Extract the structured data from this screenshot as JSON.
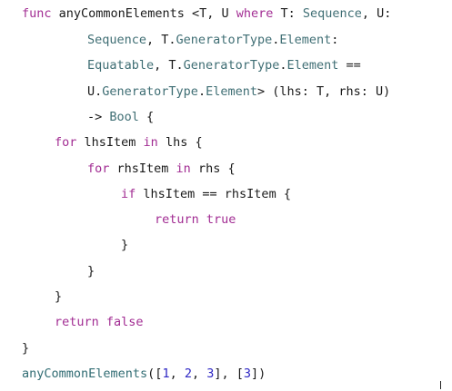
{
  "code_lines": [
    [
      {
        "t": "func",
        "c": "kw"
      },
      {
        "t": " ",
        "c": "pl"
      },
      {
        "t": "anyCommonElements",
        "c": "pl"
      },
      {
        "t": " <T, U ",
        "c": "pl"
      },
      {
        "t": "where",
        "c": "kw"
      },
      {
        "t": " T: ",
        "c": "pl"
      },
      {
        "t": "Sequence",
        "c": "ty"
      },
      {
        "t": ", U:",
        "c": "pl"
      }
    ],
    [
      {
        "t": "Sequence",
        "c": "ty"
      },
      {
        "t": ", T.",
        "c": "pl"
      },
      {
        "t": "GeneratorType",
        "c": "ty"
      },
      {
        "t": ".",
        "c": "pl"
      },
      {
        "t": "Element",
        "c": "ty"
      },
      {
        "t": ":",
        "c": "pl"
      }
    ],
    [
      {
        "t": "Equatable",
        "c": "ty"
      },
      {
        "t": ", T.",
        "c": "pl"
      },
      {
        "t": "GeneratorType",
        "c": "ty"
      },
      {
        "t": ".",
        "c": "pl"
      },
      {
        "t": "Element",
        "c": "ty"
      },
      {
        "t": " ==",
        "c": "pl"
      }
    ],
    [
      {
        "t": "U.",
        "c": "pl"
      },
      {
        "t": "GeneratorType",
        "c": "ty"
      },
      {
        "t": ".",
        "c": "pl"
      },
      {
        "t": "Element",
        "c": "ty"
      },
      {
        "t": "> (lhs: T, rhs: U)",
        "c": "pl"
      }
    ],
    [
      {
        "t": "-> ",
        "c": "pl"
      },
      {
        "t": "Bool",
        "c": "ty"
      },
      {
        "t": " {",
        "c": "pl"
      }
    ],
    [
      {
        "t": "for",
        "c": "kw"
      },
      {
        "t": " lhsItem ",
        "c": "pl"
      },
      {
        "t": "in",
        "c": "kw"
      },
      {
        "t": " lhs {",
        "c": "pl"
      }
    ],
    [
      {
        "t": "for",
        "c": "kw"
      },
      {
        "t": " rhsItem ",
        "c": "pl"
      },
      {
        "t": "in",
        "c": "kw"
      },
      {
        "t": " rhs {",
        "c": "pl"
      }
    ],
    [
      {
        "t": "if",
        "c": "kw"
      },
      {
        "t": " lhsItem == rhsItem {",
        "c": "pl"
      }
    ],
    [
      {
        "t": "return",
        "c": "kw"
      },
      {
        "t": " ",
        "c": "pl"
      },
      {
        "t": "true",
        "c": "kw"
      }
    ],
    [
      {
        "t": "}",
        "c": "pl"
      }
    ],
    [
      {
        "t": "}",
        "c": "pl"
      }
    ],
    [
      {
        "t": "}",
        "c": "pl"
      }
    ],
    [
      {
        "t": "return",
        "c": "kw"
      },
      {
        "t": " ",
        "c": "pl"
      },
      {
        "t": "false",
        "c": "kw"
      }
    ],
    [
      {
        "t": "}",
        "c": "pl"
      }
    ],
    [
      {
        "t": "anyCommonElements",
        "c": "fn"
      },
      {
        "t": "([",
        "c": "pl"
      },
      {
        "t": "1",
        "c": "num"
      },
      {
        "t": ", ",
        "c": "pl"
      },
      {
        "t": "2",
        "c": "num"
      },
      {
        "t": ", ",
        "c": "pl"
      },
      {
        "t": "3",
        "c": "num"
      },
      {
        "t": "], [",
        "c": "pl"
      },
      {
        "t": "3",
        "c": "num"
      },
      {
        "t": "])",
        "c": "pl"
      }
    ]
  ],
  "colors": {
    "keyword": "#a22d93",
    "type": "#3f6e74",
    "function": "#326d74",
    "number": "#2d26c4",
    "plain": "#1a1a1a",
    "background": "#ffffff"
  }
}
